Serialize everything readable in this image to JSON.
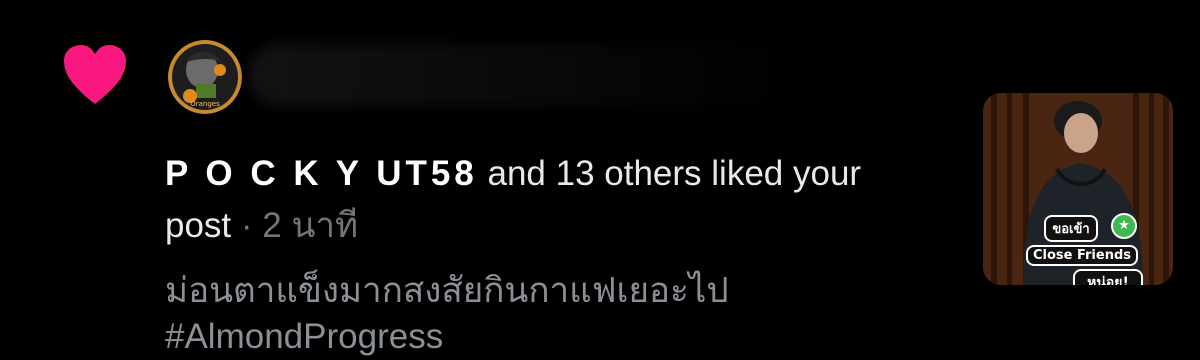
{
  "notification": {
    "type_icon": "heart-icon",
    "accent_color": "#f91880",
    "username": "P O C K Y UT58",
    "action_text": " and 13 others liked your post",
    "separator": " · ",
    "time_ago": "2 นาที",
    "post_text_line1": "ม่อนตาแข็งมากสงสัยกินกาแฟเยอะไป",
    "post_text_line2": "#AlmondProgress",
    "thumbnail": {
      "icon": "post-media-thumbnail",
      "sticker_line1": "ขอเข้า",
      "sticker_line2": "Close Friends",
      "sticker_line3": "หน่อย!"
    },
    "avatar_caption": "Oranges"
  }
}
